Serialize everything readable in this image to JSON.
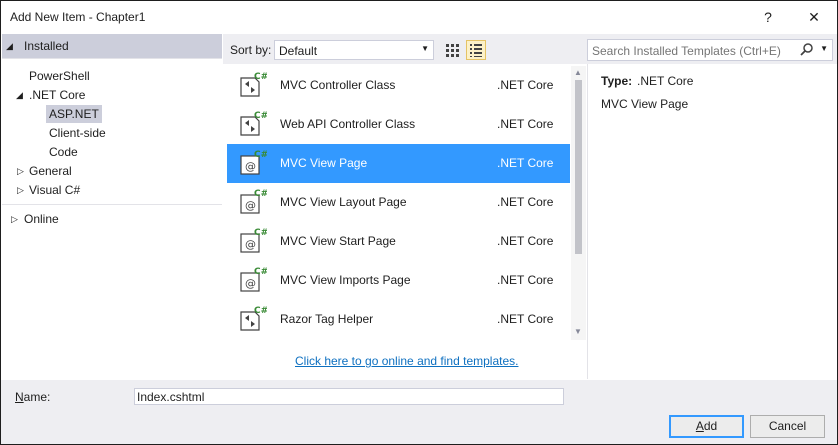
{
  "window": {
    "title": "Add New Item - Chapter1",
    "help_label": "?",
    "close_label": "✕"
  },
  "tree": {
    "installed": "Installed",
    "powershell": "PowerShell",
    "netcore": ".NET Core",
    "aspnet": "ASP.NET",
    "clientside": "Client-side",
    "code": "Code",
    "general": "General",
    "visualcsharp": "Visual C#",
    "online": "Online"
  },
  "toolbar": {
    "sort_label": "Sort by:",
    "sort_value": "Default",
    "search_placeholder": "Search Installed Templates (Ctrl+E)"
  },
  "templates": [
    {
      "name": "MVC Controller Class",
      "lang": ".NET Core",
      "icon": "controller-icon",
      "selected": false
    },
    {
      "name": "Web API Controller Class",
      "lang": ".NET Core",
      "icon": "controller-icon",
      "selected": false
    },
    {
      "name": "MVC View Page",
      "lang": ".NET Core",
      "icon": "razor-view-icon",
      "selected": true
    },
    {
      "name": "MVC View Layout Page",
      "lang": ".NET Core",
      "icon": "razor-view-icon",
      "selected": false
    },
    {
      "name": "MVC View Start Page",
      "lang": ".NET Core",
      "icon": "razor-view-icon",
      "selected": false
    },
    {
      "name": "MVC View Imports Page",
      "lang": ".NET Core",
      "icon": "razor-view-icon",
      "selected": false
    },
    {
      "name": "Razor Tag Helper",
      "lang": ".NET Core",
      "icon": "controller-icon",
      "selected": false
    }
  ],
  "online_link": "Click here to go online and find templates.",
  "details": {
    "type_label": "Type:",
    "type_value": ".NET Core",
    "description": "MVC View Page"
  },
  "bottom": {
    "name_label_prefix": "N",
    "name_label_rest": "ame:",
    "name_value": "Index.cshtml",
    "add_prefix": "A",
    "add_rest": "dd",
    "cancel_label": "Cancel"
  },
  "colors": {
    "selection": "#3399ff",
    "panel": "#eeeef2",
    "tree_selection": "#cccedb",
    "link": "#0e70c0",
    "csharp_green": "#388a34"
  }
}
